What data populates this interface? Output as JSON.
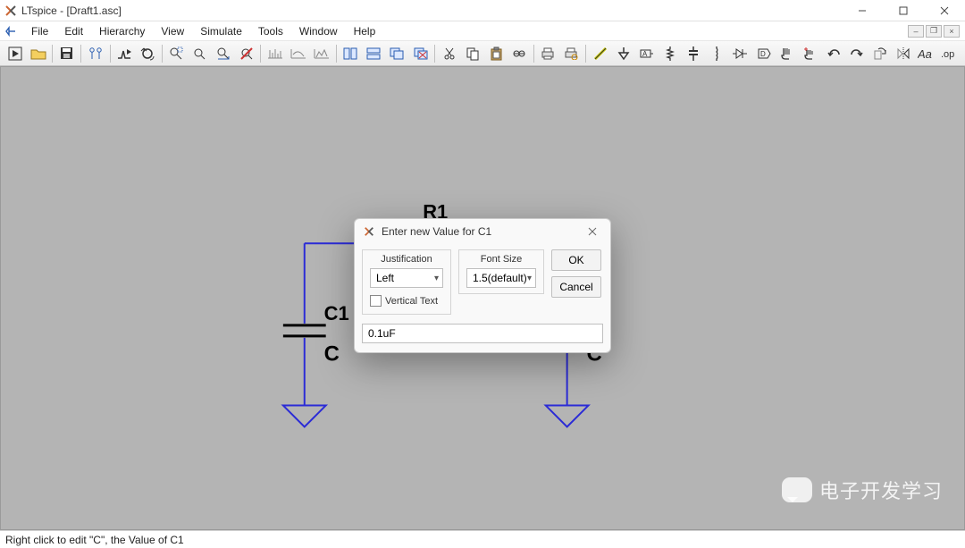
{
  "window": {
    "title": "LTspice - [Draft1.asc]"
  },
  "menus": [
    "File",
    "Edit",
    "Hierarchy",
    "View",
    "Simulate",
    "Tools",
    "Window",
    "Help"
  ],
  "schematic": {
    "r1_label": "R1",
    "c1_label": "C1",
    "c1_val": "C",
    "c2_val": "C"
  },
  "dialog": {
    "title": "Enter new Value for C1",
    "justification_label": "Justification",
    "justification_value": "Left",
    "fontsize_label": "Font Size",
    "fontsize_value": "1.5(default)",
    "vertical_text_label": "Vertical Text",
    "ok_label": "OK",
    "cancel_label": "Cancel",
    "input_value": "0.1uF"
  },
  "statusbar": {
    "text": "Right click to edit \"C\", the Value of C1"
  },
  "watermark": {
    "text": "电子开发学习"
  }
}
